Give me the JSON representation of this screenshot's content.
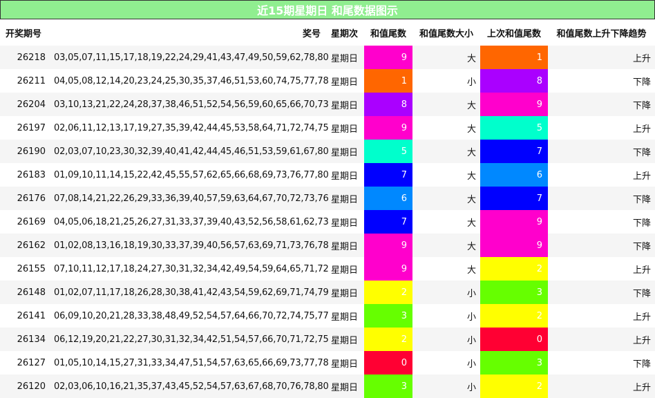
{
  "title": "近15期星期日 和尾数据图示",
  "headers": [
    "开奖期号",
    "奖号",
    "星期次",
    "和值尾数",
    "和值尾数大小",
    "上次和值尾数",
    "和值尾数上升下降趋势"
  ],
  "rows": [
    {
      "issue": "26218",
      "nums": "03,05,07,11,15,17,18,19,22,24,29,41,43,47,49,50,59,62,78,80",
      "week": "星期日",
      "tail": "9",
      "tail_color": "#ff00cc",
      "size": "大",
      "prev": "1",
      "prev_color": "#ff6600",
      "trend": "上升"
    },
    {
      "issue": "26211",
      "nums": "04,05,08,12,14,20,23,24,25,30,35,37,46,51,53,60,74,75,77,78",
      "week": "星期日",
      "tail": "1",
      "tail_color": "#ff6600",
      "size": "小",
      "prev": "8",
      "prev_color": "#aa00ff",
      "trend": "下降"
    },
    {
      "issue": "26204",
      "nums": "03,10,13,21,22,24,28,37,38,46,51,52,54,56,59,60,65,66,70,73",
      "week": "星期日",
      "tail": "8",
      "tail_color": "#aa00ff",
      "size": "大",
      "prev": "9",
      "prev_color": "#ff00cc",
      "trend": "下降"
    },
    {
      "issue": "26197",
      "nums": "02,06,11,12,13,17,19,27,35,39,42,44,45,53,58,64,71,72,74,75",
      "week": "星期日",
      "tail": "9",
      "tail_color": "#ff00cc",
      "size": "大",
      "prev": "5",
      "prev_color": "#00ffcc",
      "trend": "上升"
    },
    {
      "issue": "26190",
      "nums": "02,03,07,10,23,30,32,39,40,41,42,44,45,46,51,53,59,61,67,80",
      "week": "星期日",
      "tail": "5",
      "tail_color": "#00ffcc",
      "size": "大",
      "prev": "7",
      "prev_color": "#0000ff",
      "trend": "下降"
    },
    {
      "issue": "26183",
      "nums": "01,09,10,11,14,15,22,42,45,55,57,62,65,66,68,69,73,76,77,80",
      "week": "星期日",
      "tail": "7",
      "tail_color": "#0000ff",
      "size": "大",
      "prev": "6",
      "prev_color": "#0088ff",
      "trend": "上升"
    },
    {
      "issue": "26176",
      "nums": "07,08,14,21,22,26,29,33,36,39,40,57,59,63,64,67,70,72,73,76",
      "week": "星期日",
      "tail": "6",
      "tail_color": "#0088ff",
      "size": "大",
      "prev": "7",
      "prev_color": "#0000ff",
      "trend": "下降"
    },
    {
      "issue": "26169",
      "nums": "04,05,06,18,21,25,26,27,31,33,37,39,40,43,52,56,58,61,62,73",
      "week": "星期日",
      "tail": "7",
      "tail_color": "#0000ff",
      "size": "大",
      "prev": "9",
      "prev_color": "#ff00cc",
      "trend": "下降"
    },
    {
      "issue": "26162",
      "nums": "01,02,08,13,16,18,19,30,33,37,39,40,56,57,63,69,71,73,76,78",
      "week": "星期日",
      "tail": "9",
      "tail_color": "#ff00cc",
      "size": "大",
      "prev": "9",
      "prev_color": "#ff00cc",
      "trend": "下降"
    },
    {
      "issue": "26155",
      "nums": "07,10,11,12,17,18,24,27,30,31,32,34,42,49,54,59,64,65,71,72",
      "week": "星期日",
      "tail": "9",
      "tail_color": "#ff00cc",
      "size": "大",
      "prev": "2",
      "prev_color": "#ffff00",
      "trend": "上升"
    },
    {
      "issue": "26148",
      "nums": "01,02,07,11,17,18,26,28,30,38,41,42,43,54,59,62,69,71,74,79",
      "week": "星期日",
      "tail": "2",
      "tail_color": "#ffff00",
      "size": "小",
      "prev": "3",
      "prev_color": "#66ff00",
      "trend": "下降"
    },
    {
      "issue": "26141",
      "nums": "06,09,10,20,21,28,33,38,48,49,52,54,57,64,66,70,72,74,75,77",
      "week": "星期日",
      "tail": "3",
      "tail_color": "#66ff00",
      "size": "小",
      "prev": "2",
      "prev_color": "#ffff00",
      "trend": "上升"
    },
    {
      "issue": "26134",
      "nums": "06,12,19,20,21,22,27,30,31,32,34,42,51,54,57,66,70,71,72,75",
      "week": "星期日",
      "tail": "2",
      "tail_color": "#ffff00",
      "size": "小",
      "prev": "0",
      "prev_color": "#ff0033",
      "trend": "上升"
    },
    {
      "issue": "26127",
      "nums": "01,05,10,14,15,27,31,33,34,47,51,54,57,63,65,66,69,73,77,78",
      "week": "星期日",
      "tail": "0",
      "tail_color": "#ff0033",
      "size": "小",
      "prev": "3",
      "prev_color": "#66ff00",
      "trend": "下降"
    },
    {
      "issue": "26120",
      "nums": "02,03,06,10,16,21,35,37,43,45,52,54,57,63,67,68,70,76,78,80",
      "week": "星期日",
      "tail": "3",
      "tail_color": "#66ff00",
      "size": "小",
      "prev": "2",
      "prev_color": "#ffff00",
      "trend": "上升"
    }
  ]
}
